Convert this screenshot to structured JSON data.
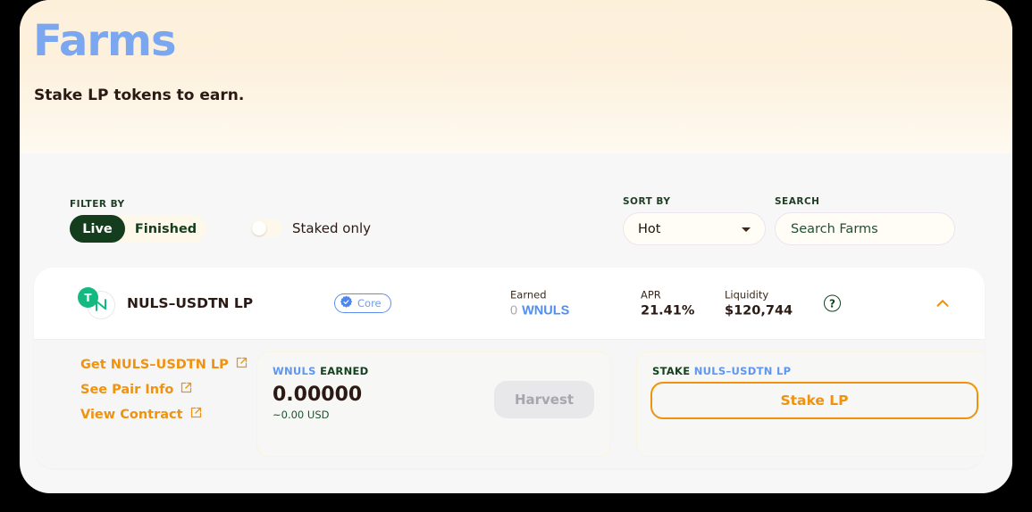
{
  "hero": {
    "title": "Farms",
    "subtitle": "Stake LP tokens to earn.",
    "title_color": "#7aa7f0"
  },
  "controls": {
    "filter_label": "FILTER BY",
    "filter_options": [
      {
        "label": "Live",
        "active": true
      },
      {
        "label": "Finished",
        "active": false
      }
    ],
    "staked_only_label": "Staked only",
    "staked_only_on": false,
    "sort_label": "SORT BY",
    "sort_value": "Hot",
    "sort_caret_icon": "chevron-down-icon",
    "search_label": "SEARCH",
    "search_value": "",
    "search_placeholder": "Search Farms"
  },
  "farm": {
    "token_a_symbol": "N",
    "token_b_symbol": "T",
    "pair_name": "NULS–USDTN LP",
    "badge_label": "Core",
    "badge_icon": "verified-badge-icon",
    "earned_label": "Earned",
    "earned_value": "0",
    "earned_symbol": "WNULS",
    "apr_label": "APR",
    "apr_value": "21.41%",
    "liquidity_label": "Liquidity",
    "liquidity_value": "$120,744",
    "help_icon": "question-mark-icon",
    "collapse_icon": "chevron-up-icon",
    "expanded": true
  },
  "expanded": {
    "links": [
      {
        "label": "Get NULS–USDTN LP",
        "icon": "external-link-icon"
      },
      {
        "label": "See Pair Info",
        "icon": "external-link-icon"
      },
      {
        "label": "View Contract",
        "icon": "external-link-icon"
      }
    ],
    "earn_panel": {
      "header_token": "WNULS",
      "header_text": "EARNED",
      "amount": "0.00000",
      "usd": "~0.00 USD",
      "harvest_label": "Harvest",
      "harvest_enabled": false
    },
    "stake_panel": {
      "header_text": "STAKE",
      "header_token": "NULS–USDTN LP",
      "button_label": "Stake LP"
    }
  },
  "theme": {
    "accent_orange": "#f0920e",
    "accent_green": "#133d1d",
    "accent_blue": "#5f96f2",
    "page_bg": "#f7f7f8"
  }
}
